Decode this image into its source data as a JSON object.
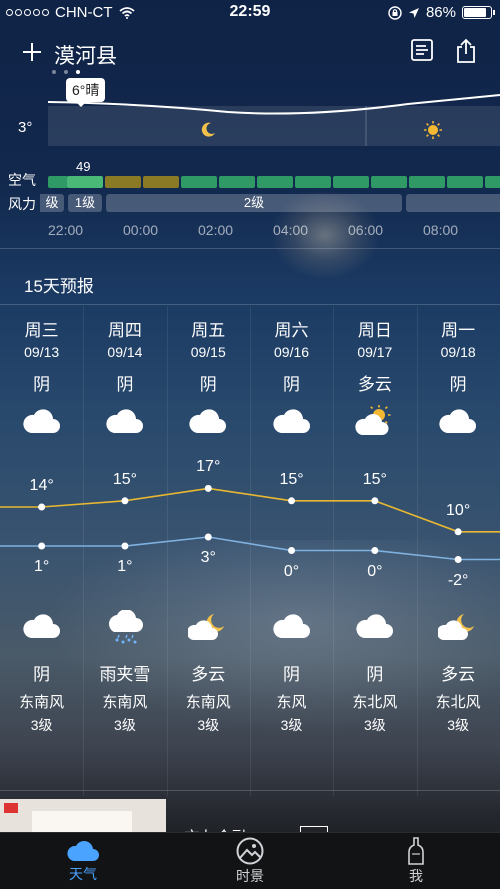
{
  "status_bar": {
    "carrier": "CHN-CT",
    "time": "22:59",
    "battery": "86%",
    "battery_level": 0.86
  },
  "header": {
    "city": "漠河县"
  },
  "hourly": {
    "current_temp_badge": "6°晴",
    "axis_temp": "3°",
    "aqi_label": "空气",
    "wind_label": "风力",
    "aqi_value": "49",
    "wind_segments": [
      "级",
      "1级",
      "2级"
    ],
    "hours": [
      "22:00",
      "00:00",
      "02:00",
      "04:00",
      "06:00",
      "08:00"
    ],
    "icons": [
      "moon-icon",
      "sun-icon"
    ],
    "aqi_colors": {
      "good": "#2f9a66",
      "highlight": "#4ab877",
      "moderate": "#8a7a25"
    }
  },
  "forecast": {
    "title": "15天预报",
    "days": [
      {
        "weekday": "周三",
        "date": "09/13",
        "day_weather": "阴",
        "day_icon": "cloud-icon",
        "high": "14°",
        "low": "1°",
        "night_icon": "cloud-icon",
        "night_weather": "阴",
        "wind_dir": "东南风",
        "wind_level": "3级"
      },
      {
        "weekday": "周四",
        "date": "09/14",
        "day_weather": "阴",
        "day_icon": "cloud-icon",
        "high": "15°",
        "low": "1°",
        "night_icon": "sleet-icon",
        "night_weather": "雨夹雪",
        "wind_dir": "东南风",
        "wind_level": "3级"
      },
      {
        "weekday": "周五",
        "date": "09/15",
        "day_weather": "阴",
        "day_icon": "cloud-icon",
        "high": "17°",
        "low": "3°",
        "night_icon": "moon-cloud-icon",
        "night_weather": "多云",
        "wind_dir": "东南风",
        "wind_level": "3级"
      },
      {
        "weekday": "周六",
        "date": "09/16",
        "day_weather": "阴",
        "day_icon": "cloud-icon",
        "high": "15°",
        "low": "0°",
        "night_icon": "cloud-icon",
        "night_weather": "阴",
        "wind_dir": "东风",
        "wind_level": "3级"
      },
      {
        "weekday": "周日",
        "date": "09/17",
        "day_weather": "多云",
        "day_icon": "sun-cloud-icon",
        "high": "15°",
        "low": "0°",
        "night_icon": "cloud-icon",
        "night_weather": "阴",
        "wind_dir": "东北风",
        "wind_level": "3级"
      },
      {
        "weekday": "周一",
        "date": "09/18",
        "day_weather": "阴",
        "day_icon": "cloud-icon",
        "high": "10°",
        "low": "-2°",
        "night_icon": "moon-cloud-icon",
        "night_weather": "多云",
        "wind_dir": "东北风",
        "wind_level": "3级"
      }
    ],
    "high_values": [
      14,
      15,
      17,
      15,
      15,
      10
    ],
    "low_values": [
      1,
      1,
      3,
      0,
      0,
      -2
    ],
    "high_line_color": "#e8b830",
    "low_line_color": "#7fb2e0"
  },
  "ad": {
    "text": "交友金融"
  },
  "tabs": [
    {
      "label": "天气",
      "icon": "cloud-icon",
      "active": true
    },
    {
      "label": "时景",
      "icon": "photo-icon",
      "active": false
    },
    {
      "label": "我",
      "icon": "bottle-icon",
      "active": false
    }
  ],
  "colors": {
    "tab_active": "#4aa3ff"
  }
}
